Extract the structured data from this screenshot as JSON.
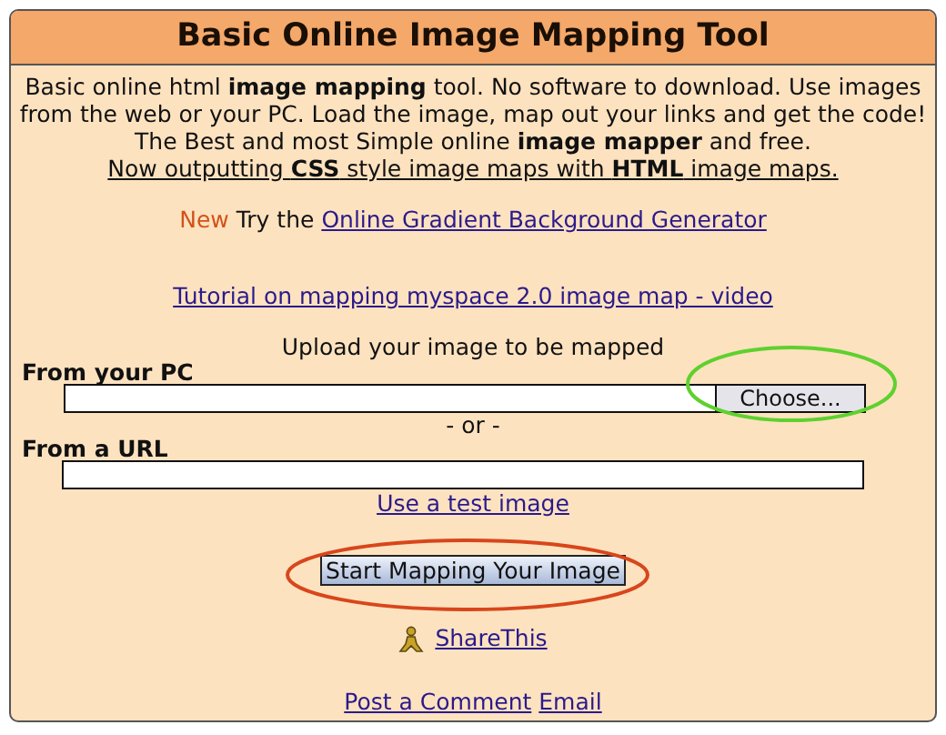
{
  "title": "Basic Online Image Mapping Tool",
  "intro": "Basic online html **image mapping** tool. No software to download. Use images from the web or your PC. Load the image, map out your links and get the code! The Best and most Simple online **image mapper** and free.",
  "intro_link": "Now outputting **CSS** style image maps with **HTML** image maps.",
  "promo": {
    "badge": "New",
    "text": "Try the",
    "link": "Online Gradient Background Generator"
  },
  "tutorial_link": "Tutorial on mapping myspace 2.0 image map - video",
  "upload_heading": "Upload your image to be mapped",
  "from_pc": {
    "label": "From your PC",
    "button": "Choose..."
  },
  "separator": "- or -",
  "from_url": {
    "label": "From a URL"
  },
  "test_image_link": "Use a test image",
  "start_button": "Start Mapping Your Image",
  "share_link": "ShareThis",
  "footer_links": [
    "Post a Comment",
    "Email"
  ]
}
